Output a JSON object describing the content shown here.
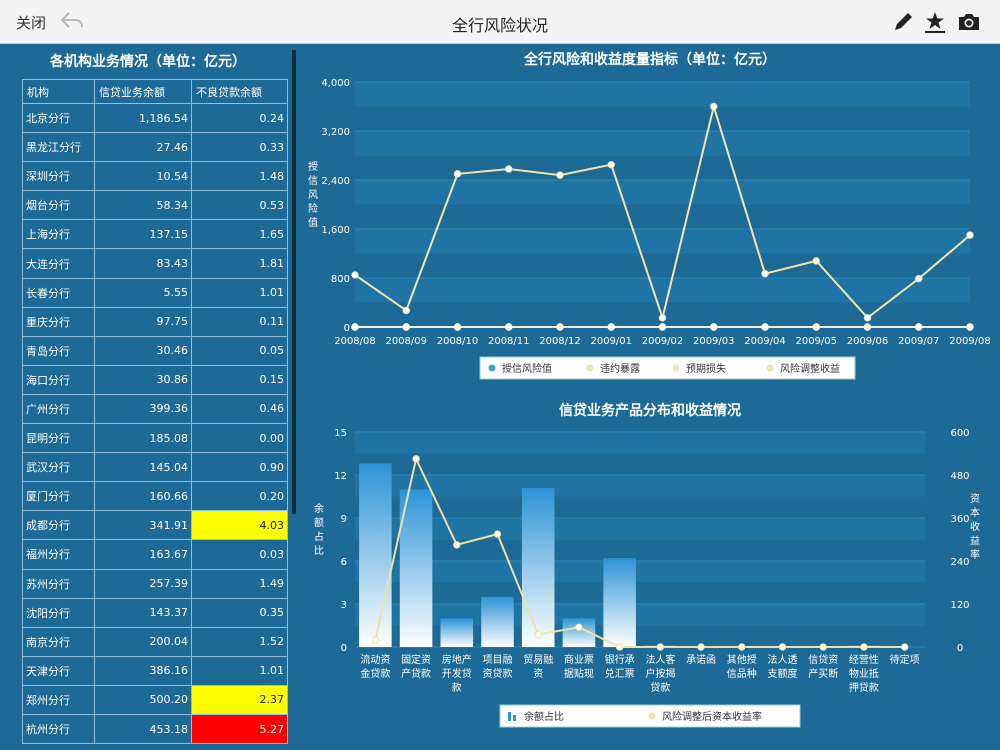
{
  "topbar": {
    "close_label": "关闭",
    "title": "全行风险状况",
    "icons": [
      "back-arrow-icon",
      "pencil-icon",
      "star-tray-icon",
      "camera-icon"
    ]
  },
  "left_panel": {
    "title": "各机构业务情况（单位：亿元）",
    "columns": [
      "机构",
      "信贷业务余额",
      "不良贷款余额"
    ],
    "rows": [
      {
        "org": "北京分行",
        "loan": "1,186.54",
        "npl": "0.24",
        "flag": ""
      },
      {
        "org": "黑龙江分行",
        "loan": "27.46",
        "npl": "0.33",
        "flag": ""
      },
      {
        "org": "深圳分行",
        "loan": "10.54",
        "npl": "1.48",
        "flag": ""
      },
      {
        "org": "烟台分行",
        "loan": "58.34",
        "npl": "0.53",
        "flag": ""
      },
      {
        "org": "上海分行",
        "loan": "137.15",
        "npl": "1.65",
        "flag": ""
      },
      {
        "org": "大连分行",
        "loan": "83.43",
        "npl": "1.81",
        "flag": ""
      },
      {
        "org": "长春分行",
        "loan": "5.55",
        "npl": "1.01",
        "flag": ""
      },
      {
        "org": "重庆分行",
        "loan": "97.75",
        "npl": "0.11",
        "flag": ""
      },
      {
        "org": "青岛分行",
        "loan": "30.46",
        "npl": "0.05",
        "flag": ""
      },
      {
        "org": "海口分行",
        "loan": "30.86",
        "npl": "0.15",
        "flag": ""
      },
      {
        "org": "广州分行",
        "loan": "399.36",
        "npl": "0.46",
        "flag": ""
      },
      {
        "org": "昆明分行",
        "loan": "185.08",
        "npl": "0.00",
        "flag": ""
      },
      {
        "org": "武汉分行",
        "loan": "145.04",
        "npl": "0.90",
        "flag": ""
      },
      {
        "org": "厦门分行",
        "loan": "160.66",
        "npl": "0.20",
        "flag": ""
      },
      {
        "org": "成都分行",
        "loan": "341.91",
        "npl": "4.03",
        "flag": "yellow"
      },
      {
        "org": "福州分行",
        "loan": "163.67",
        "npl": "0.03",
        "flag": ""
      },
      {
        "org": "苏州分行",
        "loan": "257.39",
        "npl": "1.49",
        "flag": ""
      },
      {
        "org": "沈阳分行",
        "loan": "143.37",
        "npl": "0.35",
        "flag": ""
      },
      {
        "org": "南京分行",
        "loan": "200.04",
        "npl": "1.52",
        "flag": ""
      },
      {
        "org": "天津分行",
        "loan": "386.16",
        "npl": "1.01",
        "flag": ""
      },
      {
        "org": "郑州分行",
        "loan": "500.20",
        "npl": "2.37",
        "flag": "yellow"
      },
      {
        "org": "杭州分行",
        "loan": "453.18",
        "npl": "5.27",
        "flag": "red"
      }
    ]
  },
  "chart_data": [
    {
      "type": "line",
      "title": "全行风险和收益度量指标（单位：亿元）",
      "ylabel": "授信风险值",
      "xlabel": "",
      "ylim": [
        0,
        4000
      ],
      "yticks": [
        "0",
        "800",
        "1,600",
        "2,400",
        "3,200",
        "4,000"
      ],
      "categories": [
        "2008/08",
        "2008/09",
        "2008/10",
        "2008/11",
        "2008/12",
        "2009/01",
        "2009/02",
        "2009/03",
        "2009/04",
        "2009/05",
        "2009/06",
        "2009/07",
        "2009/08"
      ],
      "series": [
        {
          "name": "授信风险值",
          "values": [
            850,
            270,
            2500,
            2580,
            2480,
            2650,
            150,
            3600,
            870,
            1080,
            150,
            790,
            1500
          ]
        },
        {
          "name": "违约暴露",
          "values": [
            0,
            0,
            0,
            0,
            0,
            0,
            0,
            0,
            0,
            0,
            0,
            0,
            0
          ]
        },
        {
          "name": "预期损失",
          "values": [
            0,
            0,
            0,
            0,
            0,
            0,
            0,
            0,
            0,
            0,
            0,
            0,
            0
          ]
        },
        {
          "name": "风险调整收益",
          "values": [
            0,
            0,
            0,
            0,
            0,
            0,
            0,
            0,
            0,
            0,
            0,
            0,
            0
          ]
        }
      ],
      "legend": "bottom",
      "colors": {
        "line": "#f1e6b0",
        "grid": "#2b7fae"
      }
    },
    {
      "type": "bar",
      "title": "信贷业务产品分布和收益情况",
      "ylabel": "余额占比",
      "y2label": "资本收益率",
      "ylim": [
        0,
        15
      ],
      "y2lim": [
        0,
        600
      ],
      "yticks": [
        "0",
        "3",
        "6",
        "9",
        "12",
        "15"
      ],
      "y2ticks": [
        "0",
        "120",
        "240",
        "360",
        "480",
        "600"
      ],
      "categories": [
        [
          "流动资",
          "金贷款"
        ],
        [
          "固定资",
          "产贷款"
        ],
        [
          "房地产",
          "开发贷",
          "款"
        ],
        [
          "项目融",
          "资贷款"
        ],
        [
          "贸易融",
          "资"
        ],
        [
          "商业票",
          "据贴现"
        ],
        [
          "银行承",
          "兑汇票"
        ],
        [
          "法人客",
          "户按揭",
          "贷款"
        ],
        [
          "承诺函"
        ],
        [
          "其他授",
          "信品种"
        ],
        [
          "法人透",
          "支额度"
        ],
        [
          "信贷资",
          "产买断"
        ],
        [
          "经营性",
          "物业抵",
          "押贷款"
        ],
        [
          "待定项"
        ]
      ],
      "series": [
        {
          "name": "余额占比",
          "type": "bar",
          "values": [
            12.8,
            11.0,
            2.0,
            3.5,
            11.1,
            2.0,
            6.2,
            0.1,
            0,
            0,
            0,
            0,
            0.1,
            0
          ]
        },
        {
          "name": "风险调整后资本收益率",
          "type": "line",
          "values": [
            20,
            525,
            285,
            315,
            35,
            55,
            0,
            0,
            0,
            0,
            0,
            0,
            0,
            0
          ]
        }
      ],
      "legend": "bottom"
    }
  ]
}
